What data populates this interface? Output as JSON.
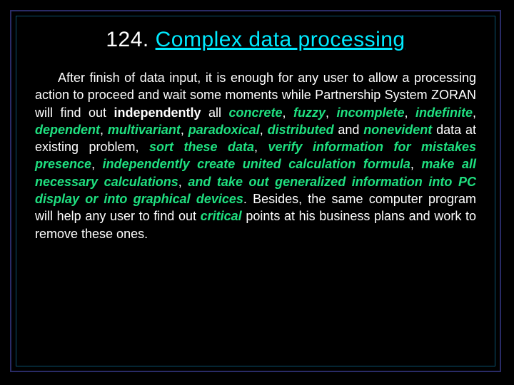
{
  "title": {
    "number": "124.",
    "text": "Complex data processing"
  },
  "body": {
    "t1": "After finish of data input, it is enough for any user to allow a processing action to proceed and wait some moments while Partnership System ZORAN will find out ",
    "indep": "independently",
    "t2": " all ",
    "kw_concrete": "concrete",
    "c1": ", ",
    "kw_fuzzy": "fuzzy",
    "c2": ", ",
    "kw_incomplete": "incomplete",
    "c3": ", ",
    "kw_indefinite": "indefinite",
    "c4": ", ",
    "kw_dependent": "dependent",
    "c5": ", ",
    "kw_multivariant": "multivariant",
    "c6": ", ",
    "kw_paradoxical": "paradoxical",
    "c7": ", ",
    "kw_distributed": "distributed",
    "t3": " and ",
    "kw_nonevident": "nonevident",
    "t4": " data at existing problem, ",
    "kw_sort": "sort these data",
    "c8": ", ",
    "kw_verify": "verify information for mistakes presence",
    "c9": ", ",
    "kw_create": "independently create united calculation formula",
    "c10": ", ",
    "kw_calc": "make all necessary calculations",
    "c11": ", ",
    "kw_take": "and take out generalized information into PC display or into graphical devices",
    "t5": ". Besides, the same computer program will help any user to find out ",
    "kw_critical": "critical",
    "t6": " points at his business plans and work to remove these ones."
  }
}
